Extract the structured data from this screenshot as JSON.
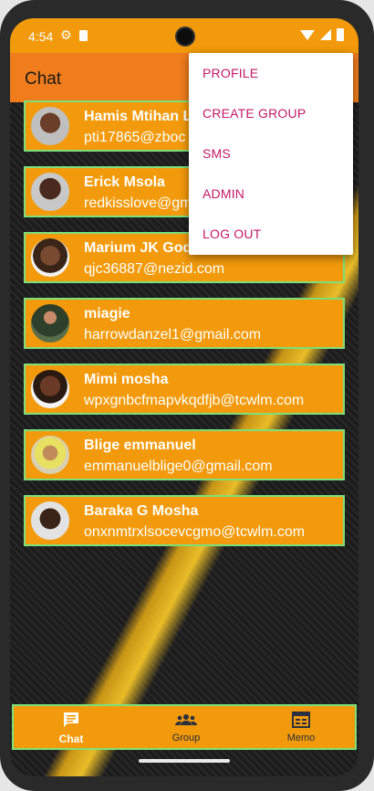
{
  "status_bar": {
    "time": "4:54"
  },
  "app_bar": {
    "title": "Chat"
  },
  "chats": [
    {
      "name": "Hamis Mtihan L",
      "email": "pti17865@zboc"
    },
    {
      "name": "Erick Msola",
      "email": "redkisslove@gm"
    },
    {
      "name": "Marium JK God",
      "email": "qjc36887@nezid.com"
    },
    {
      "name": "miagie",
      "email": "harrowdanzel1@gmail.com"
    },
    {
      "name": "Mimi mosha",
      "email": "wpxgnbcfmapvkqdfjb@tcwlm.com"
    },
    {
      "name": "Blige emmanuel",
      "email": "emmanuelblige0@gmail.com"
    },
    {
      "name": "Baraka G Mosha",
      "email": "onxnmtrxlsocevcgmo@tcwlm.com"
    }
  ],
  "menu": {
    "items": [
      "PROFILE",
      "CREATE GROUP",
      "SMS",
      "ADMIN",
      "LOG OUT"
    ]
  },
  "bottom_nav": {
    "items": [
      {
        "label": "Chat",
        "icon": "chat-icon",
        "active": true
      },
      {
        "label": "Group",
        "icon": "group-icon",
        "active": false
      },
      {
        "label": "Memo",
        "icon": "memo-icon",
        "active": false
      }
    ]
  },
  "colors": {
    "accent": "#f29a0b",
    "app_bar": "#f07c1c",
    "menu_text": "#c21868",
    "row_border": "#7be07b"
  }
}
